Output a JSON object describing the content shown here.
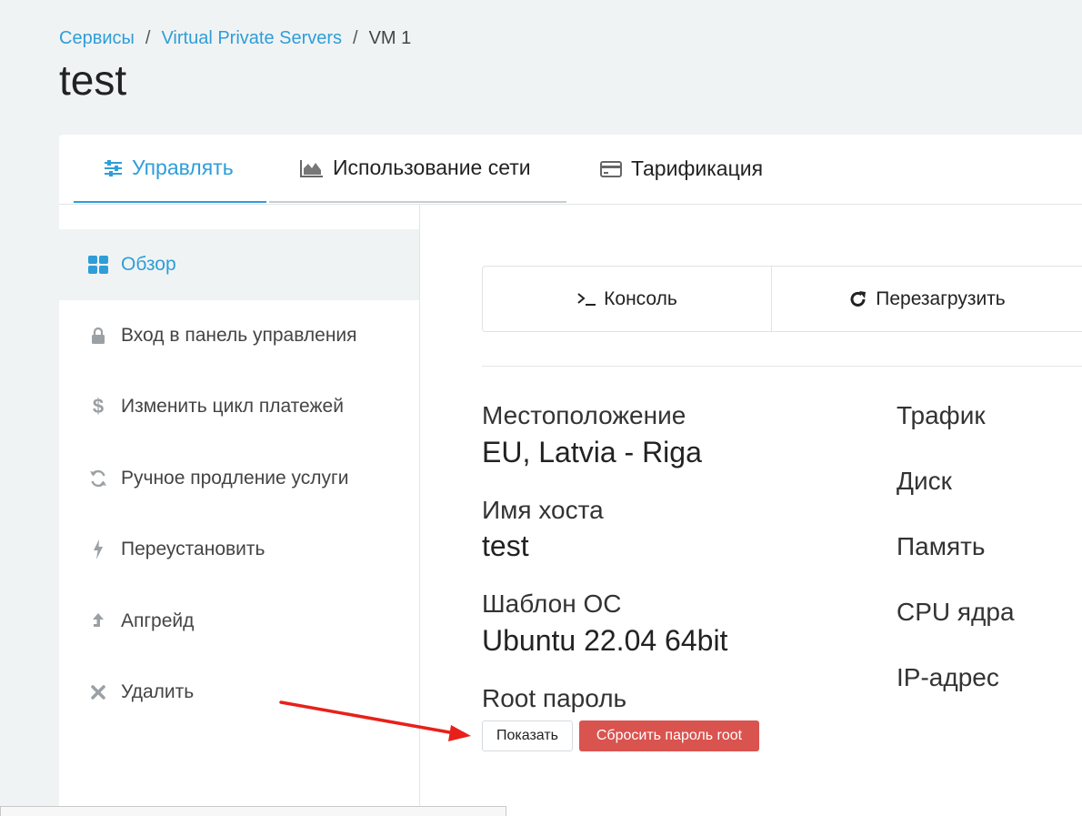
{
  "breadcrumb": {
    "items": [
      "Сервисы",
      "Virtual Private Servers",
      "VM 1"
    ],
    "separator": "/"
  },
  "page": {
    "title": "test"
  },
  "tabs": [
    {
      "label": "Управлять",
      "icon": "sliders-icon",
      "active": true
    },
    {
      "label": "Использование сети",
      "icon": "area-chart-icon",
      "active": false
    },
    {
      "label": "Тарификация",
      "icon": "credit-card-icon",
      "active": false
    }
  ],
  "sidebar": {
    "items": [
      {
        "label": "Обзор",
        "icon": "grid-icon",
        "active": true
      },
      {
        "label": "Вход в панель управления",
        "icon": "lock-icon"
      },
      {
        "label": "Изменить цикл платежей",
        "icon": "dollar-icon"
      },
      {
        "label": "Ручное продление услуги",
        "icon": "refresh-icon"
      },
      {
        "label": "Переустановить",
        "icon": "bolt-icon"
      },
      {
        "label": "Апгрейд",
        "icon": "upgrade-arrow-icon"
      },
      {
        "label": "Удалить",
        "icon": "close-icon"
      }
    ]
  },
  "actions": {
    "console_label": "Консоль",
    "console_icon": "terminal-icon",
    "reboot_label": "Перезагрузить",
    "reboot_icon": "redo-icon"
  },
  "info": {
    "location_label": "Местоположение",
    "location_value": "EU, Latvia - Riga",
    "hostname_label": "Имя хоста",
    "hostname_value": "test",
    "os_label": "Шаблон ОС",
    "os_value": "Ubuntu 22.04 64bit",
    "root_label": "Root пароль",
    "show_button": "Показать",
    "reset_button": "Сбросить пароль root"
  },
  "stats": {
    "traffic_label": "Трафик",
    "disk_label": "Диск",
    "memory_label": "Память",
    "cpu_label": "CPU ядра",
    "ip_label": "IP-адрес"
  },
  "colors": {
    "accent": "#2e9ed8",
    "danger": "#d9534f",
    "annotation_arrow": "#e8201a",
    "page_bg": "#f0f3f4"
  }
}
